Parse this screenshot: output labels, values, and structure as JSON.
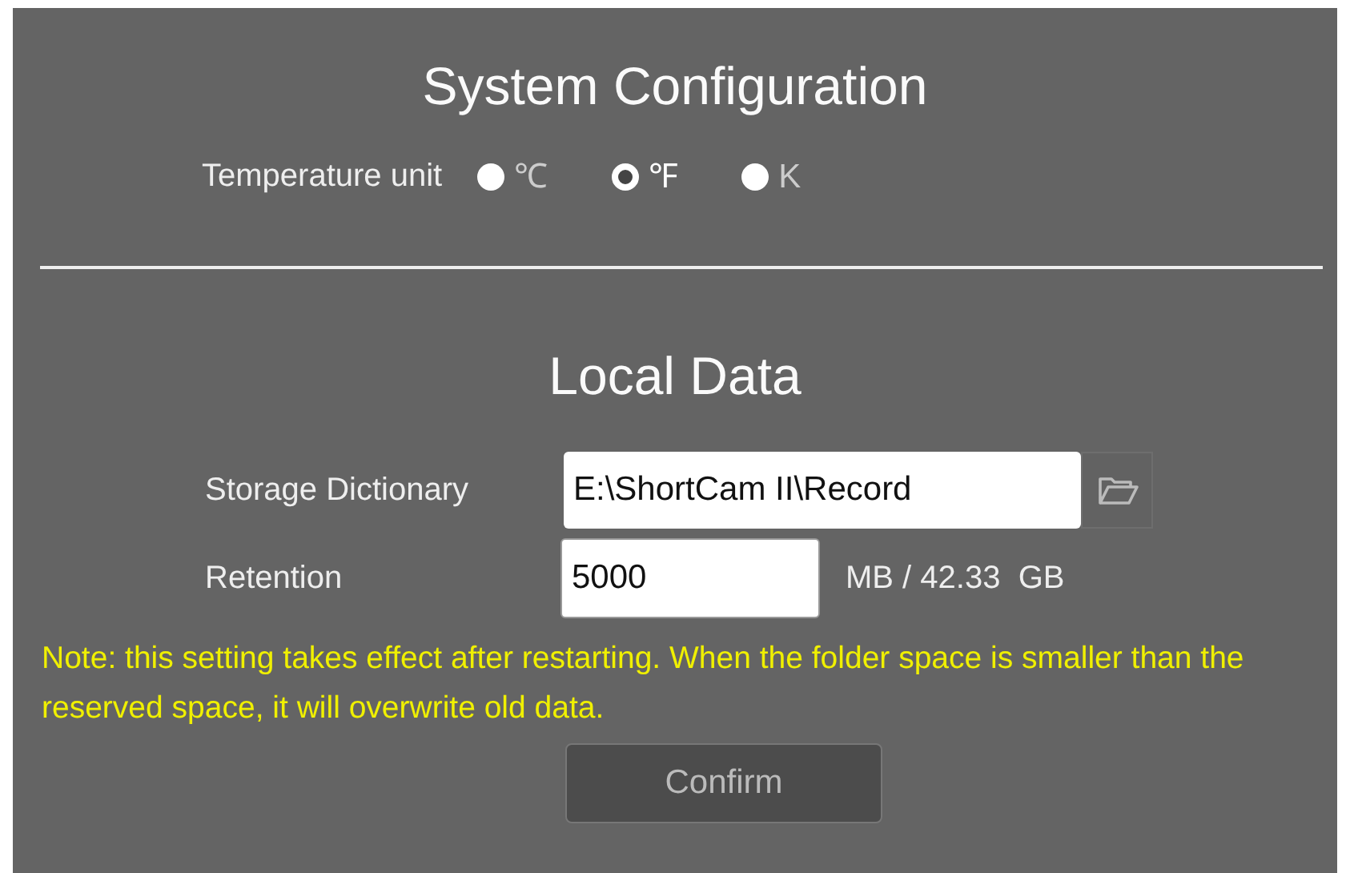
{
  "system": {
    "title": "System Configuration",
    "temperature_label": "Temperature unit",
    "units": [
      {
        "label": "℃",
        "selected": false
      },
      {
        "label": "℉",
        "selected": true
      },
      {
        "label": "K",
        "selected": false
      }
    ]
  },
  "local_data": {
    "title": "Local Data",
    "storage_label": "Storage Dictionary",
    "storage_value": "E:\\ShortCam II\\Record",
    "retention_label": "Retention",
    "retention_value": "5000",
    "retention_unit": "MB / 42.33  GB",
    "note": "Note: this setting takes effect after restarting. When the folder space is smaller than the reserved space, it will overwrite old data.",
    "confirm": {
      "label": "Confirm",
      "disabled": true
    }
  }
}
